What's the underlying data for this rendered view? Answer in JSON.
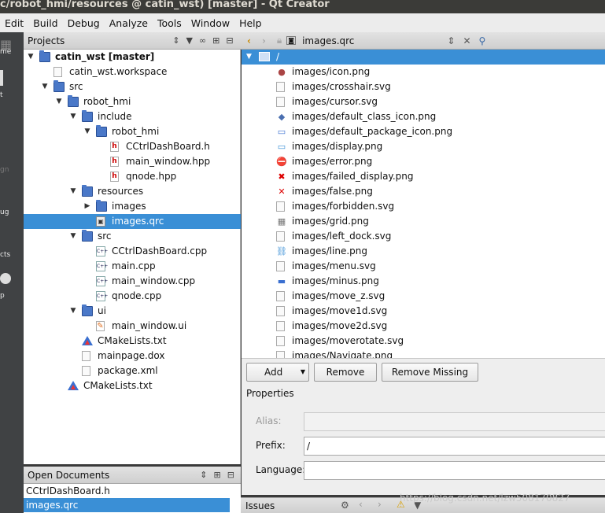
{
  "window": {
    "title": "c/robot_hmi/resources @ catin_wst) [master] - Qt Creator"
  },
  "menu": [
    "Edit",
    "Build",
    "Debug",
    "Analyze",
    "Tools",
    "Window",
    "Help"
  ],
  "modes": [
    "me",
    "t",
    "gn",
    "ug",
    "cts",
    "p"
  ],
  "projects_pane": {
    "title": "Projects",
    "tree": [
      {
        "label": "catin_wst [master]",
        "icon": "folder-icon",
        "bold": true
      },
      {
        "label": "catin_wst.workspace",
        "icon": "file-icon"
      },
      {
        "label": "src",
        "icon": "folder-icon"
      },
      {
        "label": "robot_hmi",
        "icon": "folder-icon"
      },
      {
        "label": "include",
        "icon": "folder-icon"
      },
      {
        "label": "robot_hmi",
        "icon": "folder-icon"
      },
      {
        "label": "CCtrlDashBoard.h",
        "icon": "header-file-icon"
      },
      {
        "label": "main_window.hpp",
        "icon": "header-file-icon"
      },
      {
        "label": "qnode.hpp",
        "icon": "header-file-icon"
      },
      {
        "label": "resources",
        "icon": "folder-icon"
      },
      {
        "label": "images",
        "icon": "folder-icon"
      },
      {
        "label": "images.qrc",
        "icon": "qrc-file-icon"
      },
      {
        "label": "src",
        "icon": "folder-icon"
      },
      {
        "label": "CCtrlDashBoard.cpp",
        "icon": "cpp-file-icon"
      },
      {
        "label": "main.cpp",
        "icon": "cpp-file-icon"
      },
      {
        "label": "main_window.cpp",
        "icon": "cpp-file-icon"
      },
      {
        "label": "qnode.cpp",
        "icon": "cpp-file-icon"
      },
      {
        "label": "ui",
        "icon": "folder-icon"
      },
      {
        "label": "main_window.ui",
        "icon": "ui-file-icon"
      },
      {
        "label": "CMakeLists.txt",
        "icon": "cmake-icon"
      },
      {
        "label": "mainpage.dox",
        "icon": "file-icon"
      },
      {
        "label": "package.xml",
        "icon": "file-icon"
      },
      {
        "label": "CMakeLists.txt",
        "icon": "cmake-icon"
      }
    ]
  },
  "open_documents": {
    "title": "Open Documents",
    "items": [
      "CCtrlDashBoard.h",
      "images.qrc"
    ]
  },
  "editor": {
    "current_file": "images.qrc",
    "root_prefix": "/",
    "resources": [
      "images/icon.png",
      "images/crosshair.svg",
      "images/cursor.svg",
      "images/default_class_icon.png",
      "images/default_package_icon.png",
      "images/display.png",
      "images/error.png",
      "images/failed_display.png",
      "images/false.png",
      "images/forbidden.svg",
      "images/grid.png",
      "images/left_dock.svg",
      "images/line.png",
      "images/menu.svg",
      "images/minus.png",
      "images/move_z.svg",
      "images/move1d.svg",
      "images/move2d.svg",
      "images/moverotate.svg",
      "images/Navigate.png"
    ],
    "buttons": {
      "add": "Add",
      "remove": "Remove",
      "remove_missing": "Remove Missing Files"
    },
    "properties": {
      "title": "Properties",
      "alias_label": "Alias:",
      "alias_value": "",
      "prefix_label": "Prefix:",
      "prefix_value": "/",
      "language_label": "Language:",
      "language_value": ""
    }
  },
  "bottom": {
    "issues_label": "Issues"
  },
  "watermark": "https://blog.csdn.net/lzw508170827"
}
